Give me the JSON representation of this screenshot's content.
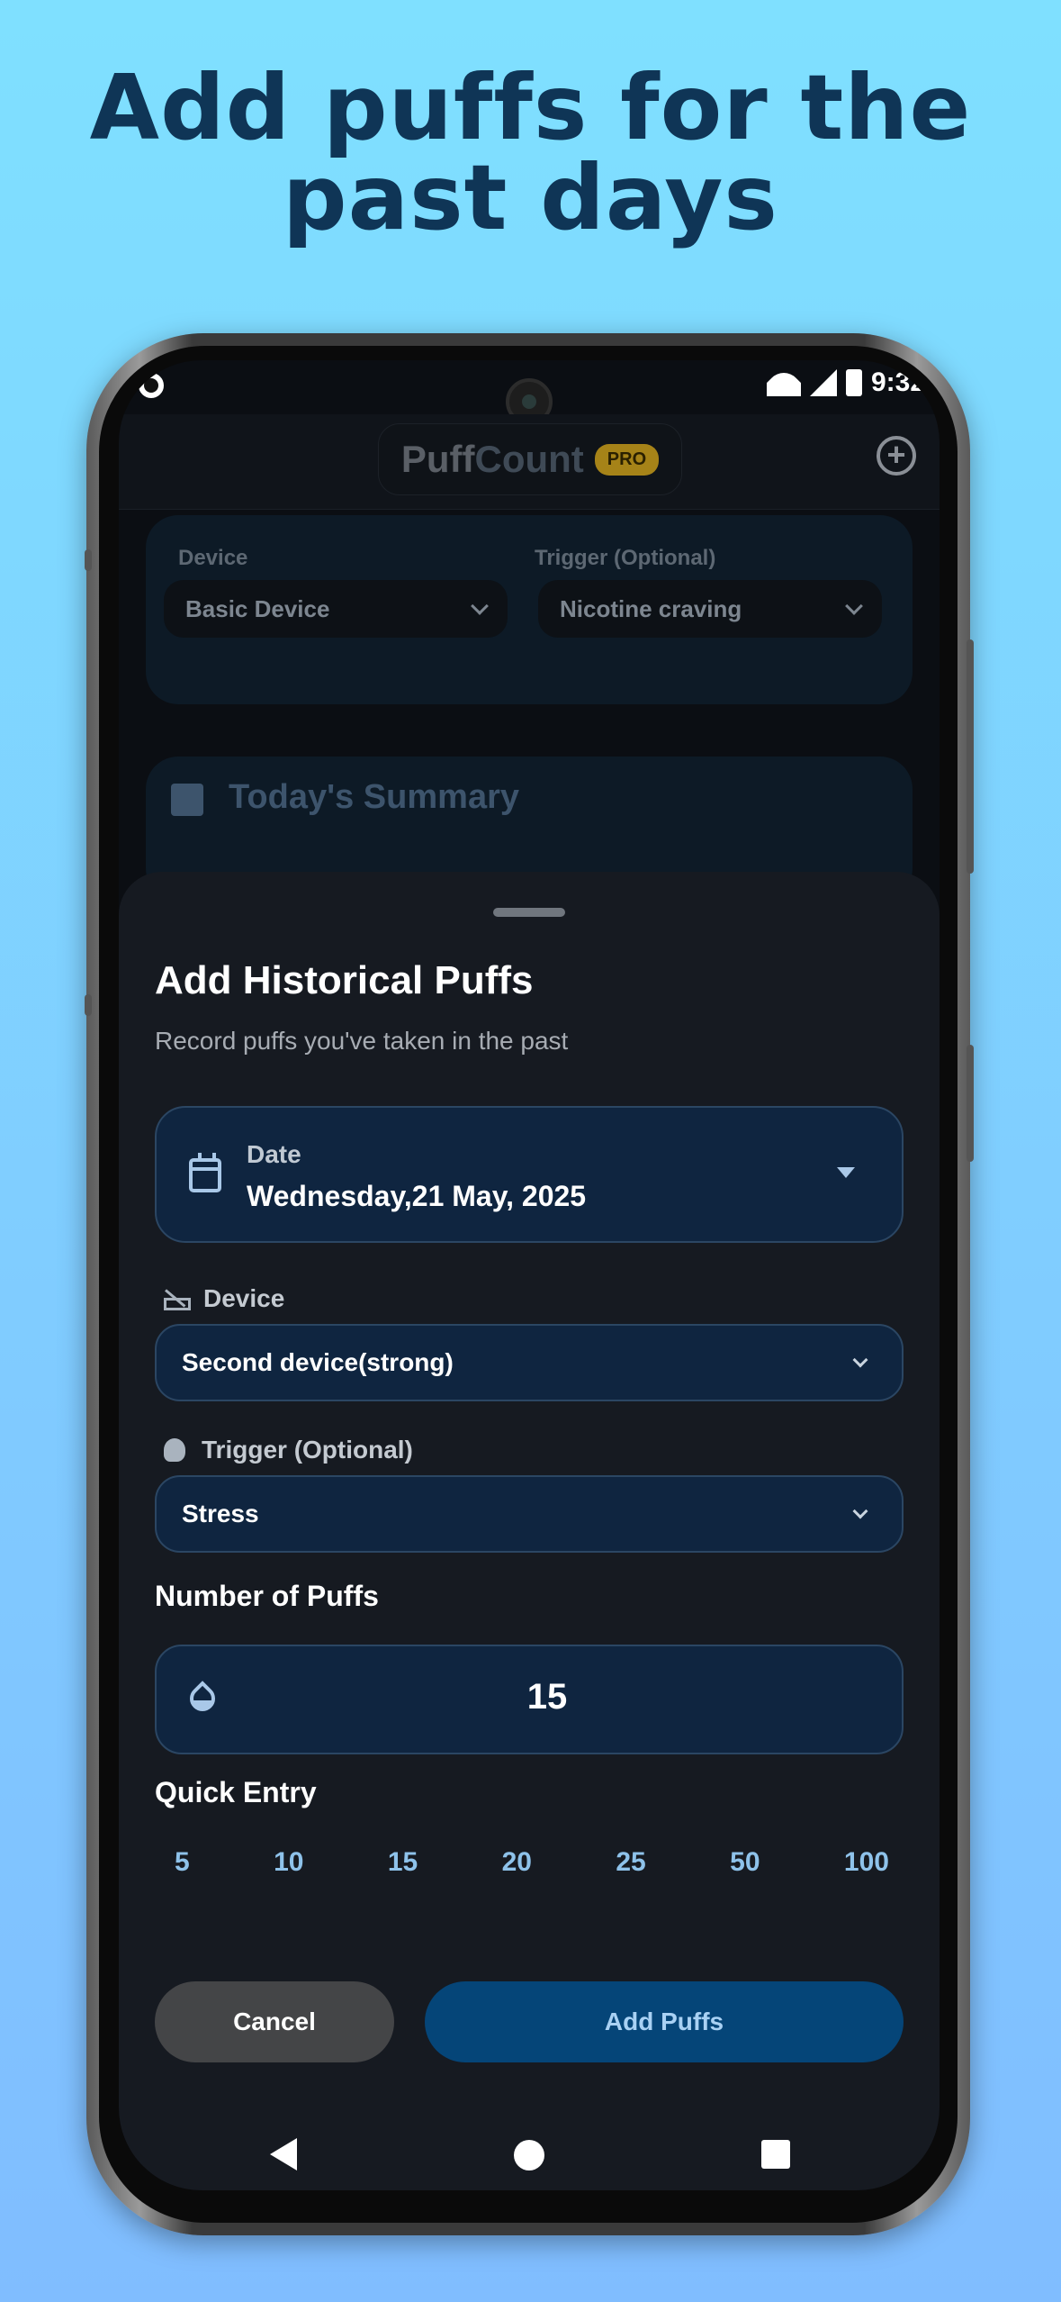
{
  "headline": {
    "line1": "Add puffs for the",
    "line2": "past days"
  },
  "status_bar": {
    "time": "9:32"
  },
  "app_header": {
    "brand_part1": "Puff",
    "brand_part2": "Count",
    "badge": "PRO",
    "add_icon": "plus-circle-icon"
  },
  "background": {
    "device_label": "Device",
    "device_value": "Basic Device",
    "trigger_label": "Trigger (Optional)",
    "trigger_value": "Nicotine craving",
    "summary_title": "Today's Summary"
  },
  "sheet": {
    "title": "Add Historical Puffs",
    "subtitle": "Record puffs you've taken in the past",
    "date": {
      "label": "Date",
      "value": "Wednesday,21 May, 2025"
    },
    "device": {
      "label": "Device",
      "value": "Second device(strong)"
    },
    "trigger": {
      "label": "Trigger (Optional)",
      "value": "Stress"
    },
    "puffs": {
      "label": "Number of Puffs",
      "value": "15"
    },
    "quick_entry": {
      "label": "Quick Entry",
      "options": [
        "5",
        "10",
        "15",
        "20",
        "25",
        "50",
        "100"
      ]
    },
    "buttons": {
      "cancel": "Cancel",
      "add": "Add Puffs"
    }
  },
  "colors": {
    "accent": "#054578",
    "field_bg": "#0f2540",
    "sheet_bg": "#161a21",
    "quick_entry": "#8ec2ea",
    "headline": "#0f3556"
  }
}
